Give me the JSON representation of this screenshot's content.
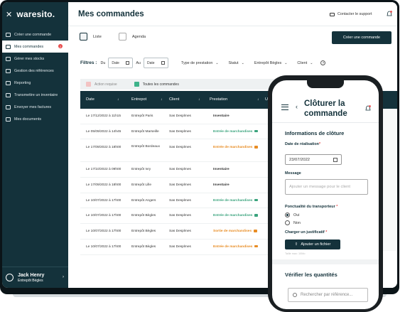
{
  "sidebar": {
    "brand": "waresito.",
    "items": [
      {
        "label": "Créer une commande",
        "icon": "cart-icon"
      },
      {
        "label": "Mes commandes",
        "icon": "list-icon",
        "active": true,
        "badge": "2"
      },
      {
        "label": "Gérer mes stocks",
        "icon": "box-icon"
      },
      {
        "label": "Gestion des références",
        "icon": "tag-icon"
      },
      {
        "label": "Reporting",
        "icon": "chart-icon"
      },
      {
        "label": "Transmettre un inventaire",
        "icon": "upload-icon"
      },
      {
        "label": "Envoyer mes factures",
        "icon": "invoice-icon"
      },
      {
        "label": "Mes documents",
        "icon": "folder-icon"
      }
    ],
    "user": {
      "name": "Jack Henry",
      "site": "Entrepôt Bègles"
    }
  },
  "header": {
    "title": "Mes commandes",
    "support": "Contacter le support"
  },
  "views": {
    "list": "Liste",
    "agenda": "Agenda"
  },
  "new_order": "Créer une commande",
  "filters": {
    "label": "Filtres :",
    "du": "Du",
    "au": "Au",
    "date_placeholder": "Date",
    "dropdowns": [
      "Type de prestation",
      "Statut",
      "Entrepôt Bègles",
      "Client"
    ]
  },
  "tabs": {
    "action": "Action requise",
    "all": "Toutes les commandes"
  },
  "table": {
    "headers": [
      "Date",
      "Entrepot",
      "Client",
      "Prestation",
      "Un"
    ],
    "rows": [
      {
        "date": "Le 17/12/2022 à 11h15",
        "entrepot": "Entrepôt Paris",
        "client": "Sas Desplmes",
        "prestation": "Inventaire",
        "kind": "plain"
      },
      {
        "date": "Le 05/09/2022 à 14h45",
        "entrepot": "Entrepôt Marseille",
        "client": "Sas Desplmes",
        "prestation": "Entrée de marchandises",
        "kind": "green"
      },
      {
        "date": "Le 17/09/2022 à 18h00",
        "entrepot": "Entrepôt Bordeaux",
        "client": "Sas Desplmes",
        "prestation": "Entrée de marchandises",
        "kind": "orange",
        "tall": true
      },
      {
        "date": "Le 17/10/2022 à 09h00",
        "entrepot": "Entrepôt Ivry",
        "client": "Sas Desplmes",
        "prestation": "Inventaire",
        "kind": "plain"
      },
      {
        "date": "Le 17/09/2022 à 18h00",
        "entrepot": "Entrepôt Lille",
        "client": "Sas Desplmes",
        "prestation": "Inventaire",
        "kind": "plain"
      },
      {
        "date": "Le 10/07/2022 à 17h00",
        "entrepot": "Entrepôt Angers",
        "client": "Sas Desplmes",
        "prestation": "Entrée de marchandises",
        "kind": "green"
      },
      {
        "date": "Le 10/07/2022 à 17h00",
        "entrepot": "Entrepôt Bègles",
        "client": "Sas Desplmes",
        "prestation": "Entrée de marchandises",
        "kind": "green"
      },
      {
        "date": "Le 10/07/2022 à 17h00",
        "entrepot": "Entrepôt Bègles",
        "client": "Sas Desplmes",
        "prestation": "Sortie de marchandises",
        "kind": "orange"
      },
      {
        "date": "Le 10/07/2022 à 17h00",
        "entrepot": "Entrepôt Bègles",
        "client": "Sas Desplmes",
        "prestation": "Entrée de marchandises",
        "kind": "orange"
      }
    ]
  },
  "mobile": {
    "title": "Clôturer la commande",
    "section1": "Informations de clôture",
    "date_label": "Date de réalisation",
    "date_value": "23/07/2022",
    "message_label": "Message",
    "message_placeholder": "Ajouter un message pour le client",
    "ponct_label": "Ponctualité du transporteur",
    "yes": "Oui",
    "no": "Non",
    "file_label": "Charger un justificatif",
    "upload_button": "Ajouter un fichier",
    "upload_hint": "Taille max: 10Mo",
    "section2": "Vérifier les quantités",
    "search_placeholder": "Rechercher par référence..."
  },
  "colors": {
    "primary": "#14323b",
    "green": "#3aa37d",
    "orange": "#e88c23",
    "alert": "#e84a4a"
  }
}
